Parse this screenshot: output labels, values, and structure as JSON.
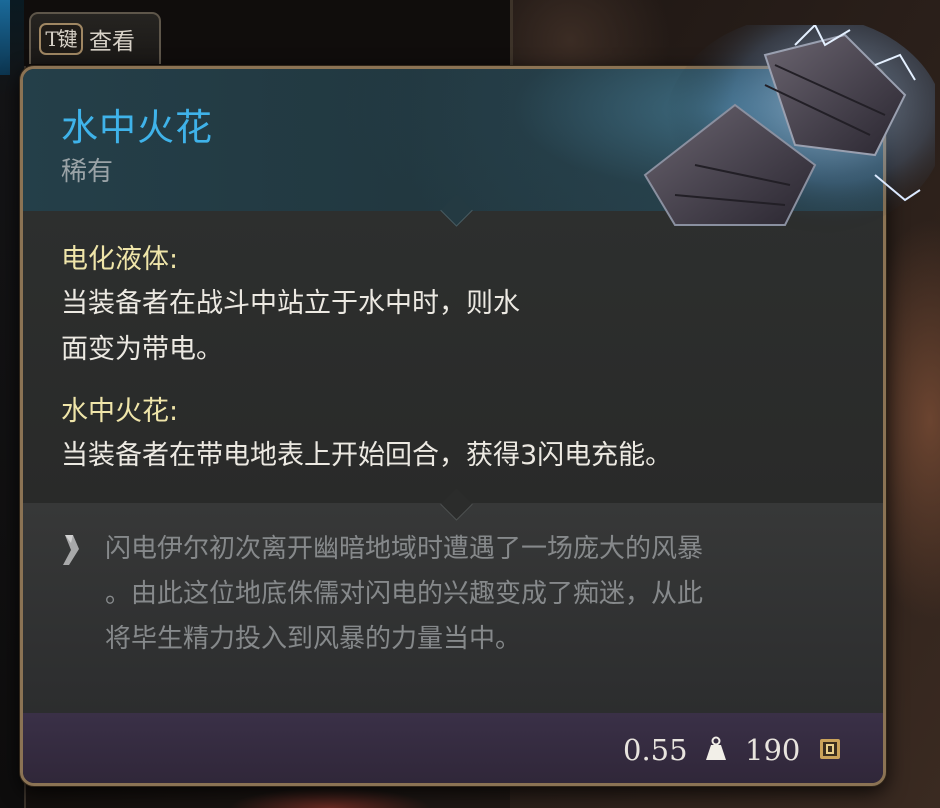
{
  "hint": {
    "key": "T键",
    "label": "查看"
  },
  "item": {
    "name": "水中火花",
    "rarity": "稀有",
    "icon": "gloves-icon"
  },
  "properties": [
    {
      "name": "电化液体:",
      "description_lines": [
        "当装备者在战斗中站立于水中时，则水",
        "面变为带电。"
      ]
    },
    {
      "name": "水中火花:",
      "description_lines": [
        "当装备者在带电地表上开始回合，获得3闪电充能。"
      ]
    }
  ],
  "lore": {
    "icon": "quill-icon",
    "lines": [
      "闪电伊尔初次离开幽暗地域时遭遇了一场庞大的风暴",
      "。由此这位地底侏儒对闪电的兴趣变成了痴迷，从此",
      "将毕生精力投入到风暴的力量当中。"
    ]
  },
  "footer": {
    "weight": "0.55",
    "weight_icon": "weight-icon",
    "price": "190",
    "price_icon": "gold-coin-icon"
  },
  "colors": {
    "title": "#3fb3ea",
    "property_name": "#efe5a9",
    "description": "#ece9e2",
    "lore": "#86898b",
    "border": "#8b7354"
  }
}
